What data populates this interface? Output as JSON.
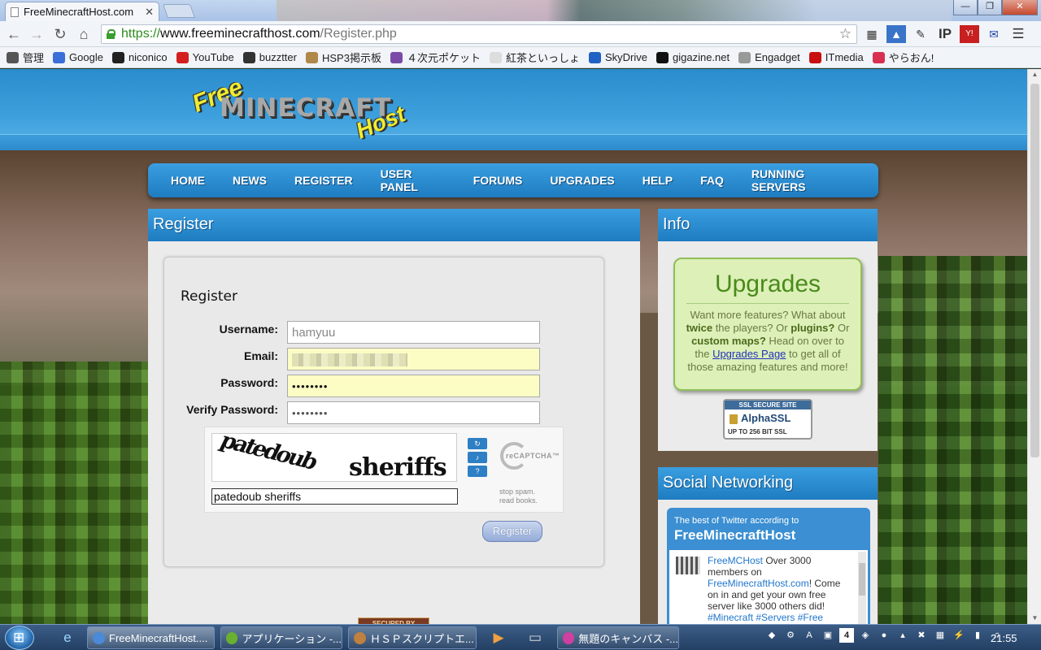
{
  "browser": {
    "tab_title": "FreeMinecraftHost.com",
    "tab_close": "✕",
    "url_scheme": "https://",
    "url_host": "www.freeminecrafthost.com",
    "url_path": "/Register.php",
    "window_buttons": {
      "minimize": "—",
      "maximize": "❐",
      "close": "✕"
    }
  },
  "bookmarks": [
    {
      "label": "管理",
      "icon": "gear-icon",
      "color": "#555555"
    },
    {
      "label": "Google",
      "icon": "google-icon",
      "color": "#3a6fd8"
    },
    {
      "label": "niconico",
      "icon": "tv-icon",
      "color": "#222222"
    },
    {
      "label": "YouTube",
      "icon": "youtube-icon",
      "color": "#d41f1f"
    },
    {
      "label": "buzztter",
      "icon": "bee-icon",
      "color": "#333333"
    },
    {
      "label": "HSP3掲示板",
      "icon": "board-icon",
      "color": "#b08848"
    },
    {
      "label": "４次元ポケット",
      "icon": "pocket-icon",
      "color": "#7a4aa8"
    },
    {
      "label": "紅茶といっしょ",
      "icon": "page-icon",
      "color": "#dddddd"
    },
    {
      "label": "SkyDrive",
      "icon": "cloud-icon",
      "color": "#1f62c4"
    },
    {
      "label": "gigazine.net",
      "icon": "gigazine-icon",
      "color": "#111111"
    },
    {
      "label": "Engadget",
      "icon": "rss-icon",
      "color": "#999999"
    },
    {
      "label": "ITmedia",
      "icon": "itmedia-icon",
      "color": "#c81010"
    },
    {
      "label": "やらおん!",
      "icon": "flower-icon",
      "color": "#d83050"
    }
  ],
  "site": {
    "logo_free": "Free",
    "logo_minecraft": "MINECRAFT",
    "logo_host": "Host",
    "nav": [
      "HOME",
      "NEWS",
      "REGISTER",
      "USER PANEL",
      "FORUMS",
      "UPGRADES",
      "HELP",
      "FAQ",
      "RUNNING SERVERS"
    ]
  },
  "register": {
    "panel_title": "Register",
    "form_title": "Register",
    "username_label": "Username:",
    "username_value": "hamyuu",
    "email_label": "Email:",
    "password_label": "Password:",
    "password_value": "••••••••",
    "verify_label": "Verify Password:",
    "verify_value": "••••••••",
    "captcha_word1": "patedoub",
    "captcha_word2": "sheriffs",
    "captcha_response": "patedoub sheriffs",
    "recaptcha_logo": "reCAPTCHA™",
    "recaptcha_tagline1": "stop spam.",
    "recaptcha_tagline2": "read books.",
    "submit_label": "Register",
    "secured_by": "SECURED BY"
  },
  "info": {
    "panel_title": "Info",
    "upgrades_title": "Upgrades",
    "t1": "Want more features? What about ",
    "b1": "twice",
    "t2": " the players? Or ",
    "b2": "plugins?",
    "t3": " Or ",
    "b3": "custom maps?",
    "t4": " Head on over to the ",
    "link": "Upgrades Page",
    "t5": " to get all of those amazing features and more!",
    "ssl_top": "SSL SECURE SITE",
    "ssl_brand": "AlphaSSL",
    "ssl_bottom": "UP TO 256 BIT SSL"
  },
  "social": {
    "panel_title": "Social Networking",
    "tw_head1": "The best of Twitter according to",
    "tw_head2": "FreeMinecraftHost",
    "tw_user": "FreeMCHost",
    "tw_text1": " Over 3000 members on ",
    "tw_link": "FreeMinecraftHost.com",
    "tw_text2": "! Come on in and get your own free server like 3000 others did! ",
    "tw_tags": "#Minecraft #Servers #Free"
  },
  "taskbar": {
    "items": [
      "FreeMinecraftHost....",
      "アプリケーション -...",
      "ＨＳＰスクリプトエ...",
      "無題のキャンバス -..."
    ],
    "tray_number": "4",
    "clock": "21:55"
  }
}
